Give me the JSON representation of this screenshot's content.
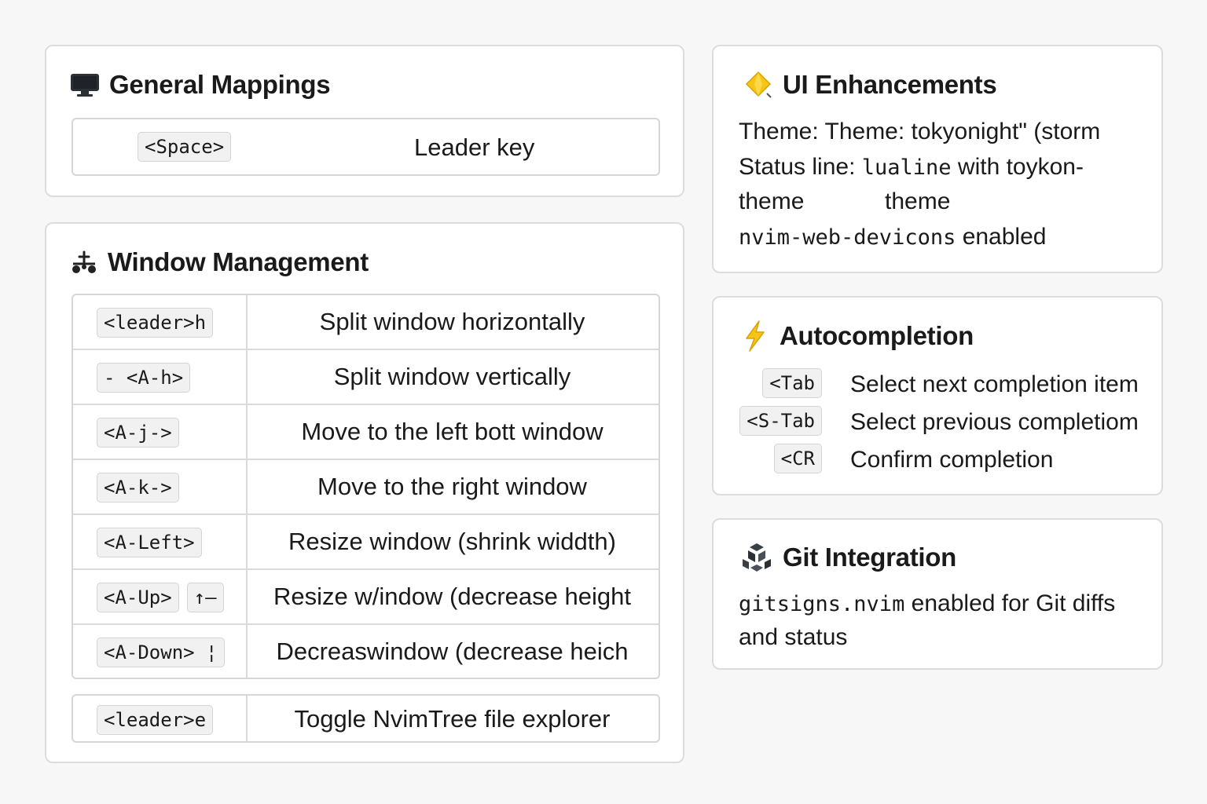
{
  "general": {
    "title": "General Mappings",
    "icon": "monitor-icon",
    "mappings": [
      {
        "key": "<Space>",
        "desc": "Leader key"
      }
    ]
  },
  "window": {
    "title": "Window Management",
    "icon": "window-split-icon",
    "rows": [
      {
        "keys": [
          "<leader>h"
        ],
        "desc": "Split window horizontally"
      },
      {
        "keys": [
          "- <A-h>"
        ],
        "desc": "Split window vertically"
      },
      {
        "keys": [
          "<A-j->"
        ],
        "desc": "Move to the left bott window"
      },
      {
        "keys": [
          "<A-k->"
        ],
        "desc": "Move to the right window"
      },
      {
        "keys": [
          "<A-Left>"
        ],
        "desc": "Resize window (shrink widdth)"
      },
      {
        "keys": [
          "<A-Up>",
          "↑–"
        ],
        "desc": "Resize w/indow (decrease height"
      },
      {
        "keys": [
          "<A-Down> ¦"
        ],
        "desc": "Decreaswindow (decrease heich"
      }
    ],
    "extra_row": {
      "key": "<leader>e",
      "desc": "Toggle NvimTree file explorer"
    }
  },
  "ui": {
    "title": "UI Enhancements",
    "icon": "diamond-sparkle-icon",
    "theme_line": "Theme: Theme: tokyonight\"  (storm",
    "status_label": "Status line:",
    "status_code": "lualine",
    "status_rest": "with toykon-",
    "status_wrap_a": "theme",
    "status_wrap_b": "theme",
    "devicons_code": "nvim-web-devicons",
    "devicons_rest": "enabled"
  },
  "autocompletion": {
    "title": "Autocompletion",
    "icon": "lightning-icon",
    "items": [
      {
        "key": "<Tab",
        "desc": "Select next completion item"
      },
      {
        "key": "<S-Tab",
        "desc": "Select previous completiom"
      },
      {
        "key": "<CR",
        "desc": "Confirm completion"
      }
    ]
  },
  "git": {
    "title": "Git Integration",
    "icon": "git-cluster-icon",
    "code": "gitsigns.nvim",
    "line1_rest": "enabled for Git diffs",
    "line2": "and status"
  },
  "colors": {
    "background": "#f7f7f7",
    "card": "#ffffff",
    "border": "#dcdcdc",
    "accent_yellow": "#f5c518"
  }
}
